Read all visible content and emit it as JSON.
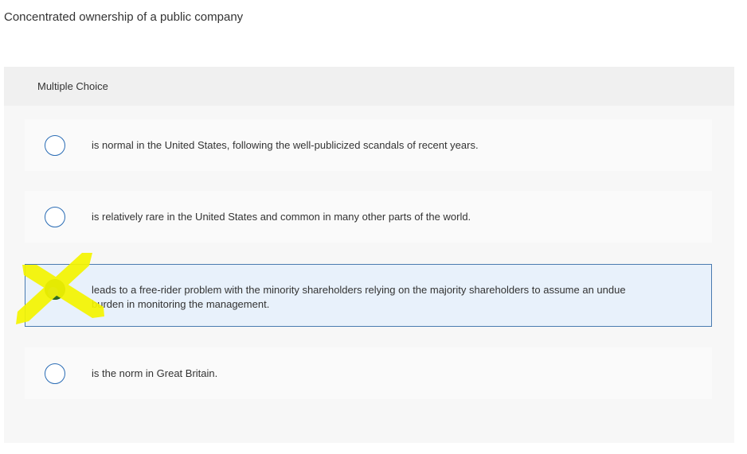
{
  "question": {
    "text": "Concentrated ownership of a public company"
  },
  "answer_panel": {
    "type_label": "Multiple Choice",
    "options": [
      {
        "label": "is normal in the United States, following the well-publicized scandals of recent years.",
        "selected": false
      },
      {
        "label": "is relatively rare in the United States and common in many other parts of the world.",
        "selected": false
      },
      {
        "label": "leads to a free-rider problem with the minority shareholders relying on the majority shareholders to assume an undue burden in monitoring the management.",
        "selected": true
      },
      {
        "label": "is the norm in Great Britain.",
        "selected": false
      }
    ]
  },
  "annotation": {
    "icon": "x-mark-highlight",
    "color": "#ffff00"
  },
  "colors": {
    "selected_background": "#e8f1fb",
    "selected_border": "#4a7bb0",
    "radio_border": "#2a6cb5"
  }
}
